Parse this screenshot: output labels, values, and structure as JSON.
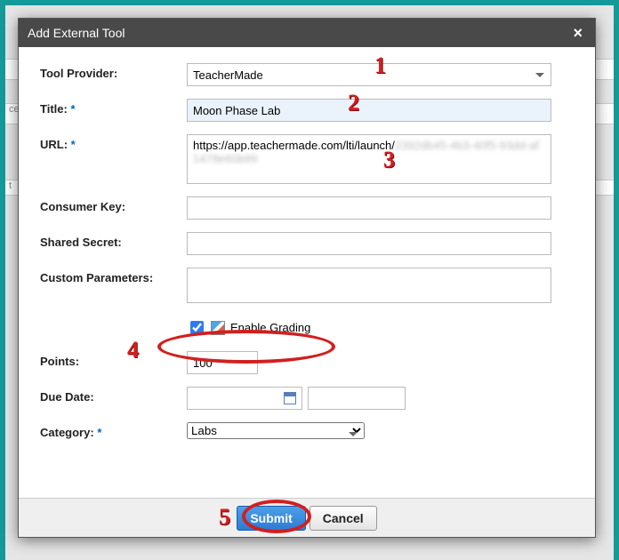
{
  "dialog": {
    "title": "Add External Tool",
    "close_symbol": "×"
  },
  "form": {
    "tool_provider": {
      "label": "Tool Provider:",
      "value": "TeacherMade"
    },
    "title": {
      "label": "Title:",
      "required": "*",
      "value": "Moon Phase Lab"
    },
    "url": {
      "label": "URL:",
      "required": "*",
      "value_visible": "https://app.teachermade.com/lti/launch/",
      "value_obscured": "2392db45-4b3-40f5-93dd-af1478e60b99"
    },
    "consumer_key": {
      "label": "Consumer Key:",
      "value": ""
    },
    "shared_secret": {
      "label": "Shared Secret:",
      "value": ""
    },
    "custom_params": {
      "label": "Custom Parameters:",
      "value": ""
    },
    "enable_grading": {
      "label": "Enable Grading",
      "checked": true
    },
    "points": {
      "label": "Points:",
      "value": "100"
    },
    "due_date": {
      "label": "Due Date:",
      "date": "",
      "time": ""
    },
    "category": {
      "label": "Category:",
      "required": "*",
      "value": "Labs"
    }
  },
  "buttons": {
    "submit": "Submit",
    "cancel": "Cancel"
  },
  "annotations": {
    "n1": "1",
    "n2": "2",
    "n3": "3",
    "n4": "4",
    "n5": "5"
  }
}
